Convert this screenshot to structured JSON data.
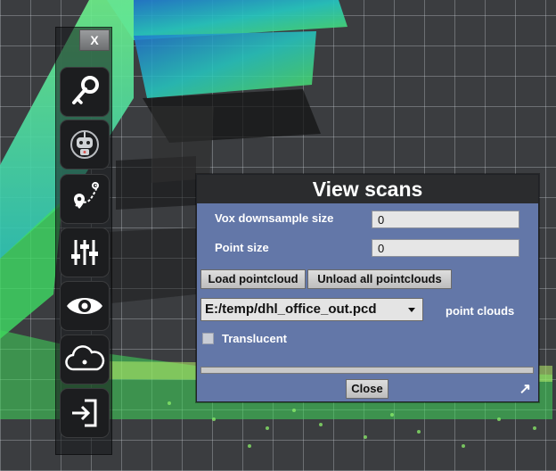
{
  "toolbar": {
    "close_label": "X",
    "buttons": [
      {
        "icon": "key-icon"
      },
      {
        "icon": "robot-icon"
      },
      {
        "icon": "route-pin-icon"
      },
      {
        "icon": "sliders-icon"
      },
      {
        "icon": "eye-icon"
      },
      {
        "icon": "cloud-icon"
      },
      {
        "icon": "exit-icon"
      }
    ]
  },
  "dialog": {
    "title": "View scans",
    "vox_label": "Vox downsample size",
    "vox_value": "0",
    "point_size_label": "Point size",
    "point_size_value": "0",
    "load_label": "Load pointcloud",
    "unload_label": "Unload all pointclouds",
    "selected_cloud": "E:/temp/dhl_office_out.pcd",
    "point_clouds_label": "point clouds",
    "translucent_label": "Translucent",
    "translucent_checked": false,
    "progress_fraction": 0.0,
    "close_label": "Close",
    "resize_glyph": "↗"
  },
  "colors": {
    "dialog_bg": "#6377a8",
    "title_bg": "#2b2c2e",
    "cloud_green": "#4cd137",
    "cloud_cyan": "#2fd3c4"
  }
}
